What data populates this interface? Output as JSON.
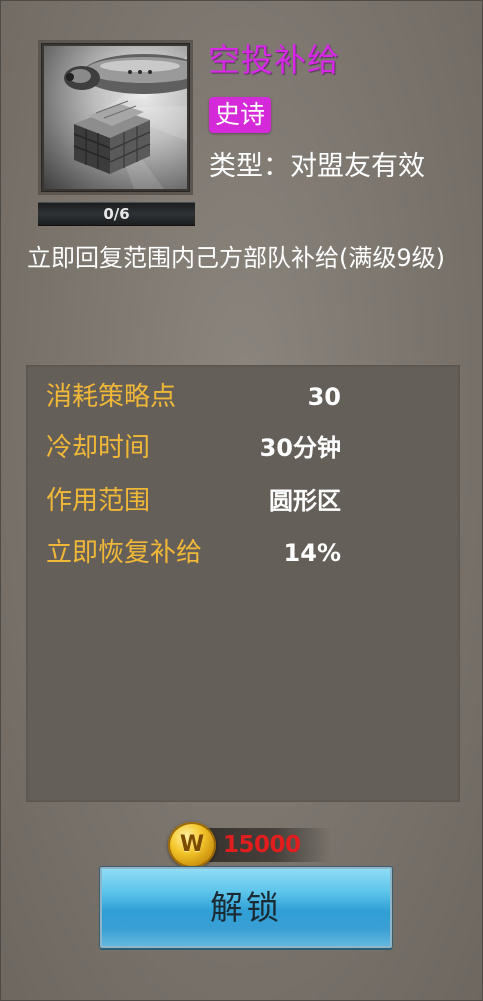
{
  "skill": {
    "name": "空投补给",
    "rarity": "史诗",
    "type": "类型：对盟友有效",
    "progress": "0/6",
    "description": "立即回复范围内己方部队补给(满级9级)",
    "icon": "airdrop-supply-crates-icon"
  },
  "stats": [
    {
      "label": "消耗策略点",
      "value": "30"
    },
    {
      "label": "冷却时间",
      "value": "30分钟"
    },
    {
      "label": "作用范围",
      "value": "圆形区"
    },
    {
      "label": "立即恢复补给",
      "value": "14%"
    }
  ],
  "cost": {
    "currency_icon": "gold-coin-w-icon",
    "coin_glyph": "W",
    "amount": "15000"
  },
  "unlock_button": {
    "label": "解锁"
  },
  "colors": {
    "skill_name": "#d628e6",
    "rarity_badge": "#d52ad9",
    "stat_label": "#f1b838",
    "cost_amount": "#e11d1d",
    "button_top": "#8fdcf5",
    "button_bottom": "#2f9fd6"
  }
}
